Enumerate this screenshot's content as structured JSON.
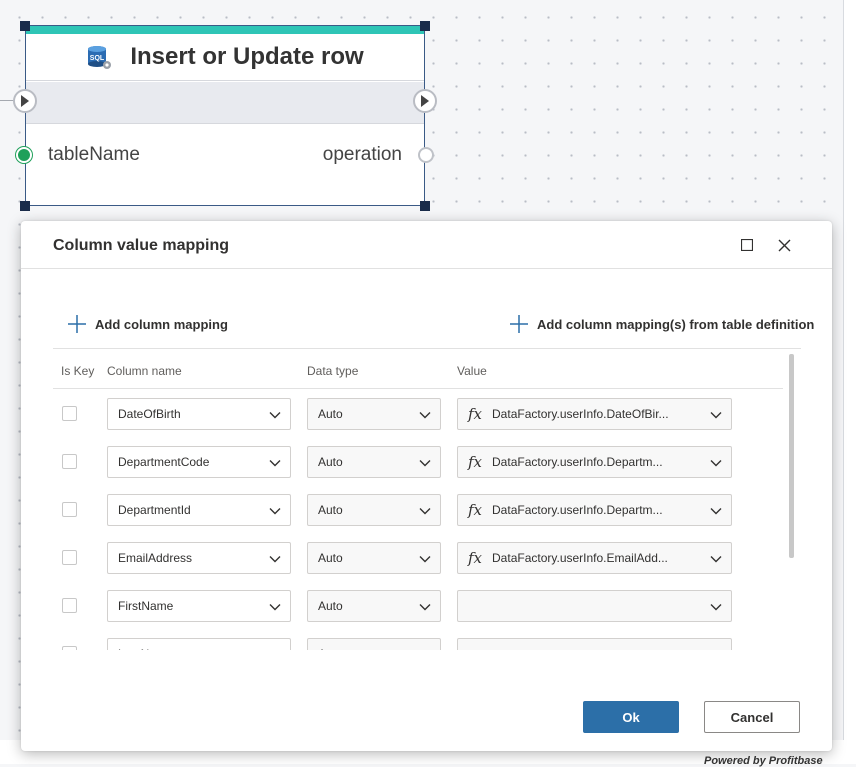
{
  "node": {
    "title": "Insert or Update row",
    "icon": "sql-database-icon",
    "icon_text": "SQL",
    "input_port_label": "tableName",
    "output_port_label": "operation",
    "accent_color": "#2ec5b6"
  },
  "dialog": {
    "title": "Column value mapping",
    "add_mapping_label": "Add column mapping",
    "add_from_table_label": "Add column mapping(s) from table definition",
    "headers": {
      "is_key": "Is Key",
      "column_name": "Column name",
      "data_type": "Data type",
      "value": "Value"
    },
    "rows": [
      {
        "column": "DateOfBirth",
        "type": "Auto",
        "has_fx": true,
        "value": "DataFactory.userInfo.DateOfBir..."
      },
      {
        "column": "DepartmentCode",
        "type": "Auto",
        "has_fx": true,
        "value": "DataFactory.userInfo.Departm..."
      },
      {
        "column": "DepartmentId",
        "type": "Auto",
        "has_fx": true,
        "value": "DataFactory.userInfo.Departm..."
      },
      {
        "column": "EmailAddress",
        "type": "Auto",
        "has_fx": true,
        "value": "DataFactory.userInfo.EmailAdd..."
      },
      {
        "column": "FirstName",
        "type": "Auto",
        "has_fx": false,
        "value": ""
      },
      {
        "column": "LastName",
        "type": "Auto",
        "has_fx": false,
        "value": ""
      }
    ],
    "fx_symbol": "fx",
    "ok_label": "Ok",
    "cancel_label": "Cancel",
    "primary_color": "#2c6fa8"
  },
  "footer": {
    "text": "Powered by Profitbase"
  }
}
